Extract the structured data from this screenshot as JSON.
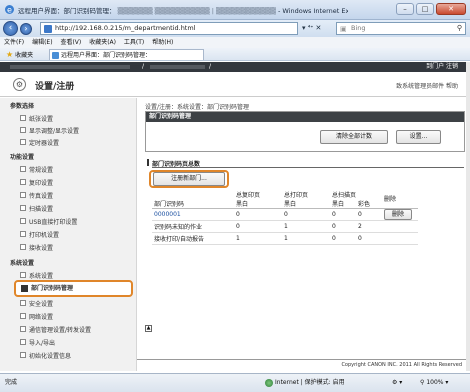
{
  "browser": {
    "window_title": "远程用户界面：部门识别码管理：",
    "window_title_suffix": "- Windows Internet Explorer",
    "url": "http://192.168.0.215/m_departmentid.html",
    "search_placeholder": "Bing",
    "menu": [
      "文件(F)",
      "编辑(E)",
      "查看(V)",
      "收藏夹(A)",
      "工具(T)",
      "帮助(H)"
    ],
    "favorites_label": "收藏夹",
    "tab_label": "远程用户界面：部门识别码管理：",
    "status_left": "完成",
    "status_zone": "Internet | 保护模式: 启用",
    "zoom": "100%"
  },
  "page": {
    "topbar_right": "到门户  注销",
    "title": "设置/注册",
    "header_links": "致系统管理员邮件  帮助",
    "breadcrumb": "设置/注册：系统设置：部门识别码管理",
    "mgmt_box_title": "部门识别码管理",
    "btn_clear_all": "清除全部计数",
    "btn_settings": "设置...",
    "section_title": "部门识别码页总数",
    "btn_register": "注册新部门...",
    "table": {
      "col_id": "部门识别码",
      "col_total_print": "总复印页",
      "col_print_pages": "总打印页",
      "col_scan_pages": "总扫描页",
      "sub_bw": "黑白",
      "sub_color": "彩色",
      "col_delete": "删除",
      "rows": [
        {
          "id": "0000001",
          "copy_bw": "0",
          "print_bw": "0",
          "scan_bw": "0",
          "scan_color": "0",
          "delete": "删除"
        },
        {
          "id": "识别码未知的作业",
          "copy_bw": "0",
          "print_bw": "1",
          "scan_bw": "0",
          "scan_color": "2",
          "delete": ""
        },
        {
          "id": "接收打印/自动报告",
          "copy_bw": "1",
          "print_bw": "1",
          "scan_bw": "0",
          "scan_color": "0",
          "delete": ""
        }
      ]
    },
    "footer": "Copyright CANON INC. 2011 All Rights Reserved"
  },
  "sidebar": {
    "sec_preferences": "参数选择",
    "pref_items": [
      "纸张设置",
      "显示调整/显示设置",
      "定时器设置"
    ],
    "sec_function": "功能设置",
    "func_items": [
      "常规设置",
      "复印设置",
      "传真设置",
      "扫描设置",
      "USB直接打印设置",
      "打印机设置",
      "接收设置"
    ],
    "sec_system": "系统设置",
    "sys_items": [
      "系统设置",
      "部门识别码管理",
      "安全设置",
      "网络设置",
      "通信管理设置/转发设置",
      "导入/导出",
      "初始化设置信息"
    ]
  },
  "colors": {
    "highlight_ring": "#e0862a",
    "dark_bar": "#33373d",
    "link_blue": "#1a4fa0"
  }
}
